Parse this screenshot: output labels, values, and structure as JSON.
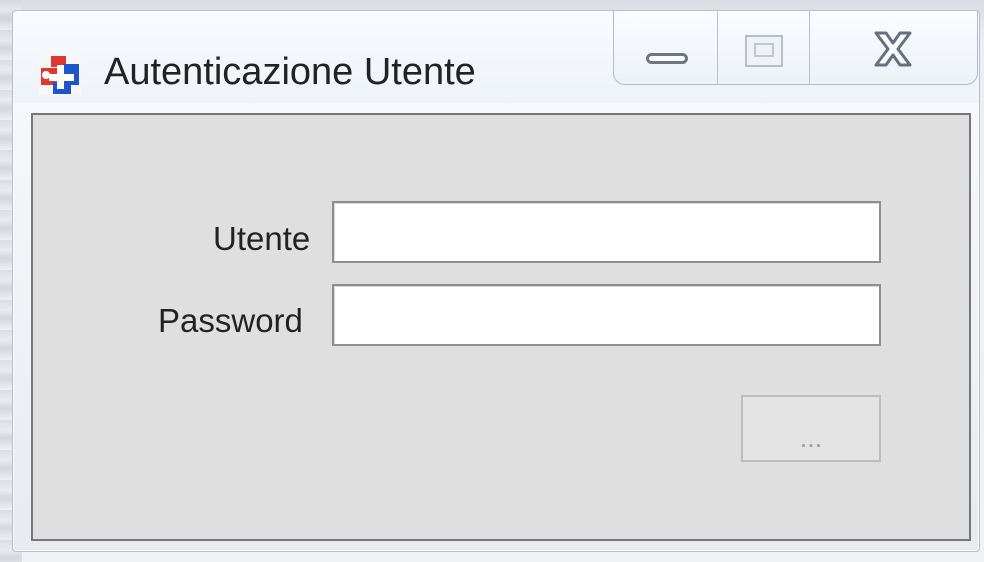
{
  "window": {
    "title": "Autenticazione Utente",
    "controls": {
      "minimize": "minimize",
      "maximize": "maximize",
      "close": "close"
    }
  },
  "login": {
    "user_label": "Utente",
    "password_label": "Password",
    "user_value": "",
    "password_value": "",
    "action_label": "..."
  },
  "icons": {
    "app": "app-icon",
    "minimize": "minimize-icon",
    "maximize": "maximize-icon",
    "close": "close-icon"
  },
  "colors": {
    "app_icon_red": "#e0372f",
    "app_icon_blue": "#1d56c8",
    "panel": "#dfdfdf"
  }
}
